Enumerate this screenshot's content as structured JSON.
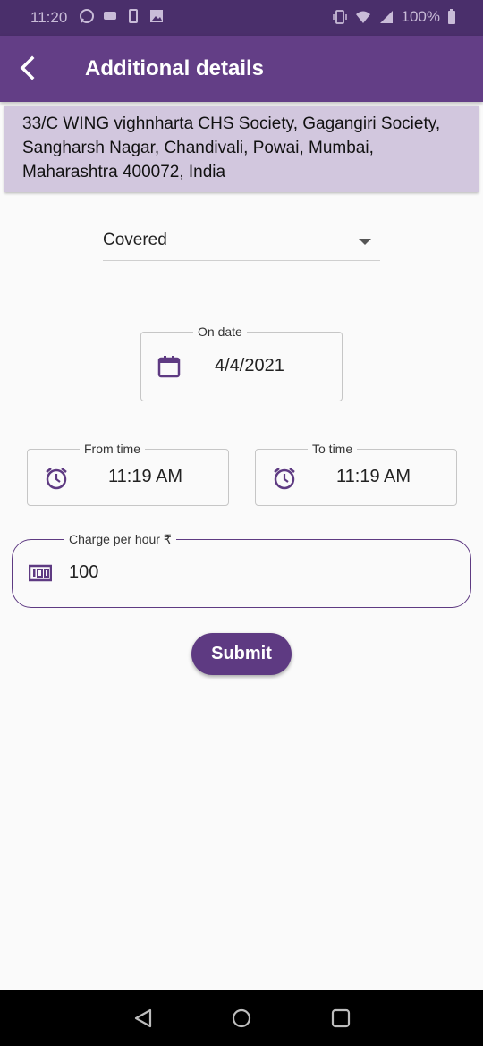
{
  "status_bar": {
    "time": "11:20",
    "battery": "100%"
  },
  "app_bar": {
    "title": "Additional details"
  },
  "address": "33/C WING vighnharta CHS Society, Gagangiri Society, Sangharsh Nagar, Chandivali, Powai, Mumbai, Maharashtra 400072, India",
  "parking_type": {
    "selected": "Covered"
  },
  "on_date": {
    "label": "On date",
    "value": "4/4/2021"
  },
  "from_time": {
    "label": "From time",
    "value": "11:19 AM"
  },
  "to_time": {
    "label": "To time",
    "value": "11:19 AM"
  },
  "charge": {
    "label": "Charge per hour ₹",
    "value": "100"
  },
  "submit_label": "Submit",
  "colors": {
    "primary": "#633e86",
    "status_bar": "#4a2f6b",
    "address_bg": "#d2c7de"
  },
  "icons": [
    "back-arrow-icon",
    "calendar-icon",
    "alarm-icon",
    "money-icon",
    "nav-back-icon",
    "nav-home-icon",
    "nav-recents-icon"
  ]
}
